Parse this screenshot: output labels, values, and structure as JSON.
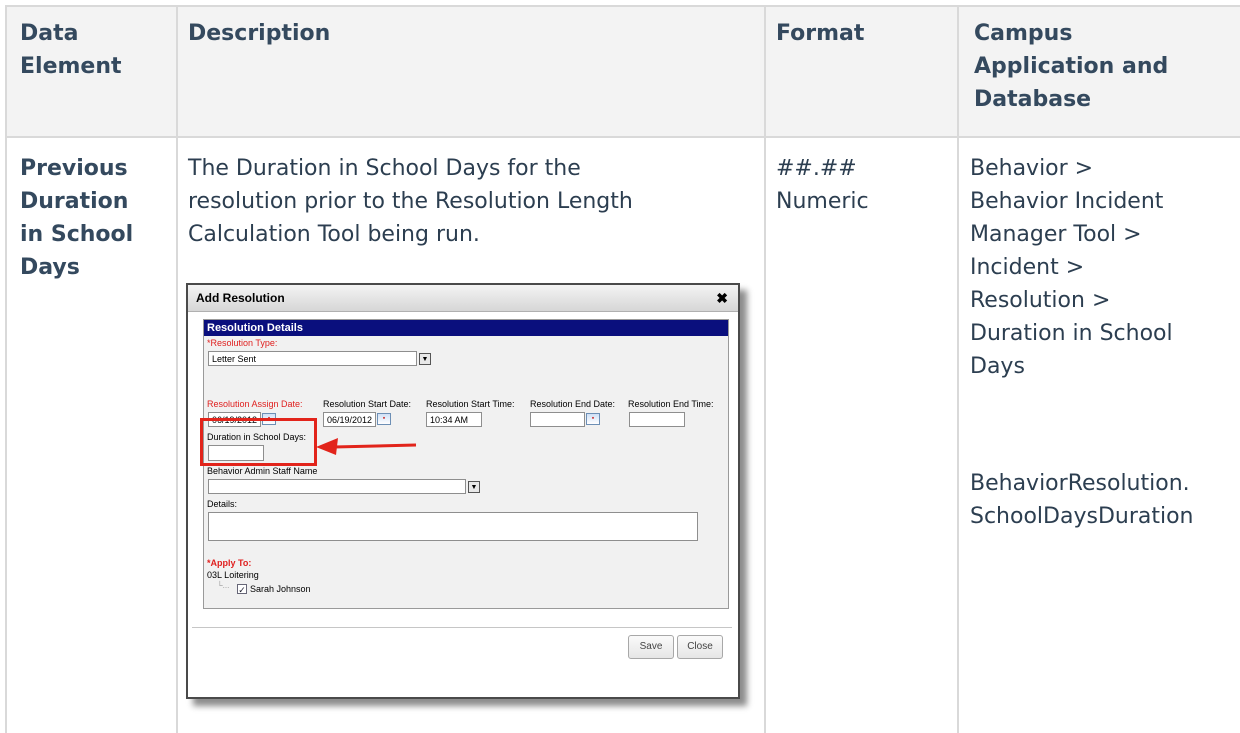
{
  "table": {
    "headers": [
      "Data Element",
      "Description",
      "Format",
      "Campus Application and Database"
    ],
    "header_lines": {
      "data_element": [
        "Data",
        "Element"
      ],
      "description": [
        "Description"
      ],
      "format": [
        "Format"
      ],
      "campus": [
        "Campus",
        "Application and",
        "Database"
      ]
    },
    "row": {
      "data_element_lines": [
        "Previous",
        "Duration",
        "in School",
        "Days"
      ],
      "description_lines": [
        "The Duration in School Days for the",
        "resolution prior to the Resolution Length",
        "Calculation Tool being run."
      ],
      "format_lines": [
        "##.##",
        "Numeric"
      ],
      "campus_lines": [
        "Behavior >",
        "Behavior Incident",
        "Manager Tool >",
        "Incident >",
        "Resolution >",
        "Duration in School",
        "Days"
      ],
      "database_lines": [
        "BehaviorResolution.",
        "SchoolDaysDuration"
      ]
    }
  },
  "screenshot": {
    "title": "Add Resolution",
    "close_glyph": "✖",
    "section": "Resolution Details",
    "resolution_type_label": "*Resolution Type:",
    "resolution_type_value": "Letter Sent",
    "assign_date_label": "Resolution Assign Date:",
    "assign_date_value": "06/19/2012",
    "start_date_label": "Resolution Start Date:",
    "start_date_value": "06/19/2012",
    "start_time_label": "Resolution Start Time:",
    "start_time_value": "10:34 AM",
    "end_date_label": "Resolution End Date:",
    "end_date_value": "",
    "end_time_label": "Resolution End Time:",
    "end_time_value": "",
    "duration_label": "Duration in School Days:",
    "duration_value": "",
    "staff_label": "Behavior Admin Staff Name",
    "staff_value": "",
    "details_label": "Details:",
    "apply_label": "*Apply To:",
    "incident": "03L Loitering",
    "student": "Sarah Johnson",
    "save_label": "Save",
    "close_label": "Close",
    "colors": {
      "title_bar_blue": "#0a0f7d",
      "required_red": "#e0201f",
      "highlight_red": "#e2241b"
    }
  }
}
